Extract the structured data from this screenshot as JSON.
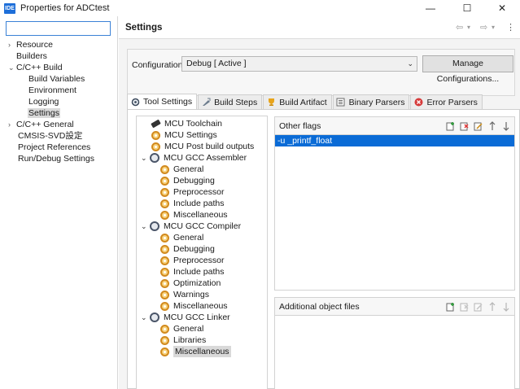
{
  "window": {
    "app_icon": "IDE",
    "title": "Properties for ADCtest",
    "minimize": "—",
    "maximize": "☐",
    "close": "✕"
  },
  "left": {
    "filter": {
      "value": "",
      "placeholder": ""
    },
    "items": [
      {
        "label": "Resource",
        "expandable": true
      },
      {
        "label": "Builders",
        "expandable": false
      },
      {
        "label": "C/C++ Build",
        "expanded": true
      },
      {
        "label": "Build Variables",
        "child": true
      },
      {
        "label": "Environment",
        "child": true
      },
      {
        "label": "Logging",
        "child": true
      },
      {
        "label": "Settings",
        "child": true,
        "selected": true
      },
      {
        "label": "C/C++ General",
        "expandable": true
      },
      {
        "label": "CMSIS-SVD設定"
      },
      {
        "label": "Project References"
      },
      {
        "label": "Run/Debug Settings"
      }
    ]
  },
  "header": {
    "title": "Settings",
    "back": "⇦",
    "back_menu": "▾",
    "forward": "⇨",
    "forward_menu": "▾",
    "menu": "⋮"
  },
  "configuration": {
    "label": "Configuration:",
    "selected": "Debug  [ Active ]",
    "manage_button": "Manage Configurations..."
  },
  "tabs": [
    {
      "label": "Tool Settings",
      "icon": "tool-settings-icon",
      "active": true
    },
    {
      "label": "Build Steps",
      "icon": "build-steps-icon"
    },
    {
      "label": "Build Artifact",
      "icon": "trophy-icon"
    },
    {
      "label": "Binary Parsers",
      "icon": "binary-icon"
    },
    {
      "label": "Error Parsers",
      "icon": "error-icon"
    }
  ],
  "tool_tree": [
    {
      "label": "MCU Toolchain",
      "icon": "toolchain-icon",
      "level": 0
    },
    {
      "label": "MCU Settings",
      "icon": "gear-icon",
      "level": 0
    },
    {
      "label": "MCU Post build outputs",
      "icon": "gear-icon",
      "level": 0
    },
    {
      "label": "MCU GCC Assembler",
      "icon": "settings-icon",
      "level": 0,
      "expanded": true
    },
    {
      "label": "General",
      "icon": "gear-icon",
      "level": 1
    },
    {
      "label": "Debugging",
      "icon": "gear-icon",
      "level": 1
    },
    {
      "label": "Preprocessor",
      "icon": "gear-icon",
      "level": 1
    },
    {
      "label": "Include paths",
      "icon": "gear-icon",
      "level": 1
    },
    {
      "label": "Miscellaneous",
      "icon": "gear-icon",
      "level": 1
    },
    {
      "label": "MCU GCC Compiler",
      "icon": "settings-icon",
      "level": 0,
      "expanded": true
    },
    {
      "label": "General",
      "icon": "gear-icon",
      "level": 1
    },
    {
      "label": "Debugging",
      "icon": "gear-icon",
      "level": 1
    },
    {
      "label": "Preprocessor",
      "icon": "gear-icon",
      "level": 1
    },
    {
      "label": "Include paths",
      "icon": "gear-icon",
      "level": 1
    },
    {
      "label": "Optimization",
      "icon": "gear-icon",
      "level": 1
    },
    {
      "label": "Warnings",
      "icon": "gear-icon",
      "level": 1
    },
    {
      "label": "Miscellaneous",
      "icon": "gear-icon",
      "level": 1
    },
    {
      "label": "MCU GCC Linker",
      "icon": "settings-icon",
      "level": 0,
      "expanded": true
    },
    {
      "label": "General",
      "icon": "gear-icon",
      "level": 1
    },
    {
      "label": "Libraries",
      "icon": "gear-icon",
      "level": 1
    },
    {
      "label": "Miscellaneous",
      "icon": "gear-icon",
      "level": 1,
      "selected": true
    }
  ],
  "other_flags": {
    "title": "Other flags",
    "values": [
      "-u _printf_float"
    ]
  },
  "additional_objects": {
    "title": "Additional object files",
    "values": []
  },
  "colors": {
    "selection": "#0a6bd6",
    "tree_selection": "#d9d9d9",
    "focus_border": "#3b82d6"
  }
}
